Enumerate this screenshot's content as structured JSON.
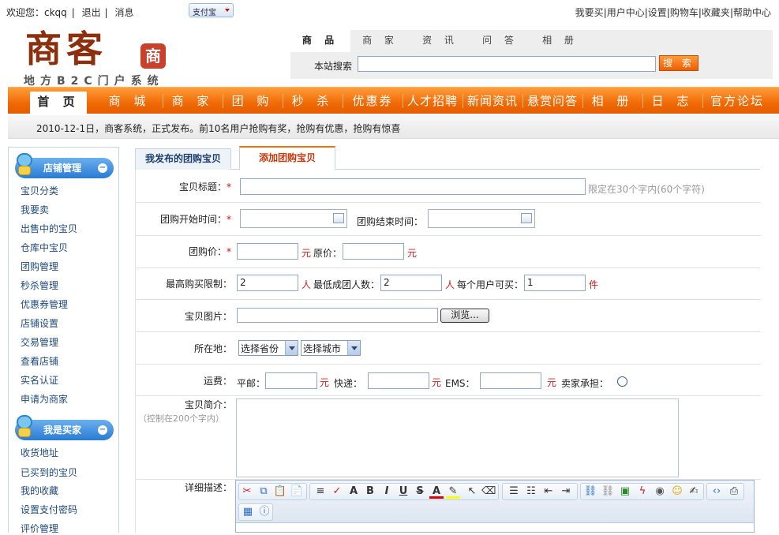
{
  "top": {
    "welcome": "欢迎您：ckqq",
    "logout": "退出",
    "messages": "消息",
    "alipay": "支付宝",
    "links": [
      "我要买",
      "用户中心",
      "设置",
      "购物车",
      "收藏夹",
      "帮助中心"
    ]
  },
  "logo": {
    "main": "商客",
    "seal": "商",
    "sub": "地方B2C门户系统"
  },
  "search": {
    "tabs": [
      "商 品",
      "商 家",
      "资 讯",
      "问 答",
      "相 册"
    ],
    "label": "本站搜索",
    "button": "搜 索",
    "value": ""
  },
  "nav": {
    "items": [
      "首 页",
      "商 城",
      "商 家",
      "团 购",
      "秒 杀",
      "优惠券",
      "人才招聘",
      "新闻资讯",
      "悬赏问答",
      "相 册",
      "日 志",
      "官方论坛"
    ]
  },
  "notice": "2010-12-1日，商客系统，正式发布。前10名用户抢购有奖，抢购有优惠，抢购有惊喜",
  "sidebar": {
    "shop_title": "店铺管理",
    "shop_links": [
      "宝贝分类",
      "我要卖",
      "出售中的宝贝",
      "仓库中宝贝",
      "团购管理",
      "秒杀管理",
      "优惠券管理",
      "店铺设置",
      "交易管理",
      "查看店铺",
      "实名认证",
      "申请为商家"
    ],
    "buyer_title": "我是买家",
    "buyer_links": [
      "收货地址",
      "已买到的宝贝",
      "我的收藏",
      "设置支付密码",
      "评价管理"
    ]
  },
  "tabs": {
    "my_items": "我发布的团购宝贝",
    "add_item": "添加团购宝贝"
  },
  "form": {
    "title_label": "宝贝标题：",
    "title_hint": "限定在30个字内(60个字符)",
    "start_label": "团购开始时间：",
    "end_label": "团购结束时间：",
    "price_label": "团购价：",
    "orig_price_label": "原价：",
    "yuan": "元",
    "max_buy_label": "最高购买限制：",
    "max_buy_value": "2",
    "person": "人",
    "min_group_label": "最低成团人数：",
    "min_group_value": "2",
    "per_user_label": "每个用户可买：",
    "per_user_value": "1",
    "piece": "件",
    "image_label": "宝贝图片：",
    "browse": "浏览...",
    "location_label": "所在地：",
    "province": "选择省份",
    "city": "选择城市",
    "shipping_label": "运费：",
    "ship_normal": "平邮：",
    "ship_express": "快递：",
    "ship_ems": "EMS：",
    "ship_seller": "卖家承担：",
    "intro_label": "宝贝简介：",
    "intro_hint": "（控制在200个字内）",
    "detail_label": "详细描述："
  },
  "toolbar_icons": [
    "cut-icon",
    "copy-icon",
    "paste-icon",
    "paste-word-icon",
    "format-icon",
    "spellcheck-icon",
    "font-size-icon",
    "bold-icon",
    "italic-icon",
    "underline-icon",
    "strike-icon",
    "font-color-icon",
    "bg-color-icon",
    "select-icon",
    "eraser-icon",
    "align-left-icon",
    "list-icon",
    "outdent-icon",
    "indent-icon",
    "link-icon",
    "unlink-icon",
    "image-icon",
    "flash-icon",
    "media-icon",
    "smiley-icon",
    "edit-icon",
    "source-icon",
    "print-icon",
    "table-icon",
    "about-icon"
  ],
  "colors": {
    "accent": "#f06a05",
    "link": "#1e4a7a",
    "unit": "#d21d1d"
  }
}
